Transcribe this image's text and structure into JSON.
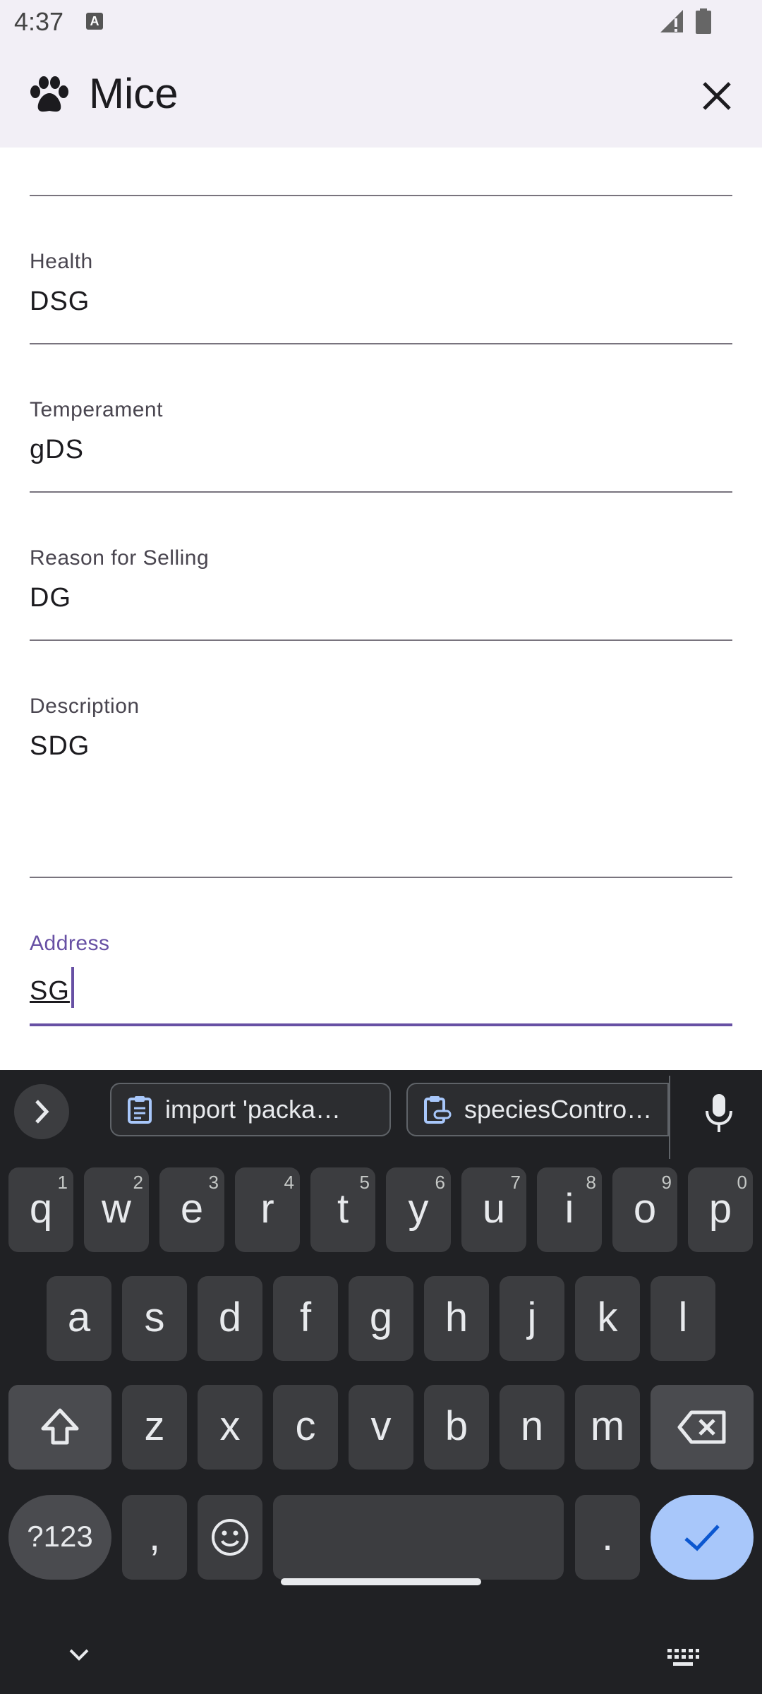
{
  "status_bar": {
    "time": "4:37",
    "notification_letter": "A"
  },
  "app_bar": {
    "title": "Mice"
  },
  "fields": [
    {
      "label": "",
      "value": ""
    },
    {
      "label": "Health",
      "value": "DSG"
    },
    {
      "label": "Temperament",
      "value": "gDS"
    },
    {
      "label": "Reason for Selling",
      "value": "DG"
    },
    {
      "label": "Description",
      "value": "SDG"
    },
    {
      "label": "Address",
      "value": "SG"
    }
  ],
  "keyboard": {
    "clipboard_chips": [
      "import 'packa…",
      "speciesContro…"
    ],
    "row1": [
      {
        "k": "q",
        "h": "1"
      },
      {
        "k": "w",
        "h": "2"
      },
      {
        "k": "e",
        "h": "3"
      },
      {
        "k": "r",
        "h": "4"
      },
      {
        "k": "t",
        "h": "5"
      },
      {
        "k": "y",
        "h": "6"
      },
      {
        "k": "u",
        "h": "7"
      },
      {
        "k": "i",
        "h": "8"
      },
      {
        "k": "o",
        "h": "9"
      },
      {
        "k": "p",
        "h": "0"
      }
    ],
    "row2": [
      "a",
      "s",
      "d",
      "f",
      "g",
      "h",
      "j",
      "k",
      "l"
    ],
    "row3": [
      "z",
      "x",
      "c",
      "v",
      "b",
      "n",
      "m"
    ],
    "symbols_label": "?123",
    "comma_label": ",",
    "period_label": "."
  },
  "colors": {
    "accent": "#6750a4",
    "enter_key": "#a8c7fa",
    "keyboard_bg": "#202124"
  }
}
